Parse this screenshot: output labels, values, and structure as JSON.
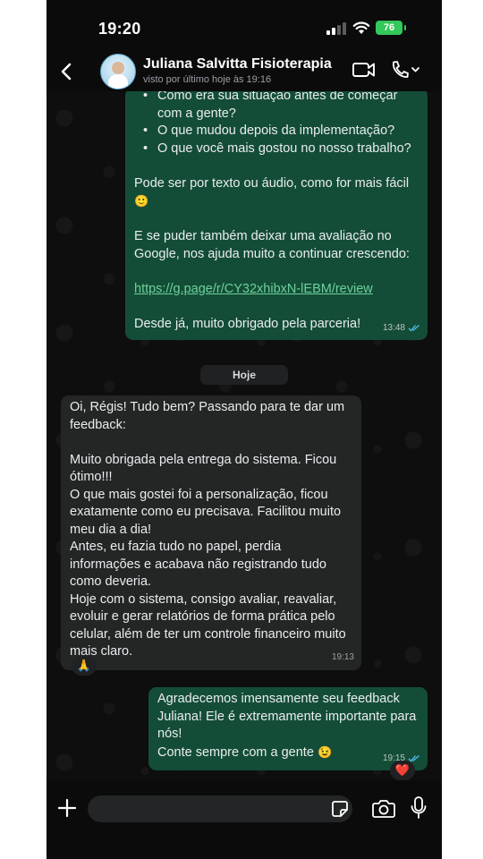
{
  "status_bar": {
    "time": "19:20",
    "battery": "76"
  },
  "header": {
    "contact_name": "Juliana Salvitta Fisioterapia",
    "last_seen": "visto por último hoje às 19:16"
  },
  "messages": {
    "m1": {
      "bullets": [
        "Como era sua situação antes de começar com a gente?",
        "O que mudou depois da implementação?",
        "O que você mais gostou no nosso trabalho?"
      ],
      "text_1": "Pode ser por texto ou áudio, como for mais fácil",
      "text_1_emoji": "🙂",
      "text_2": "E se puder também deixar uma avaliação no Google, nos ajuda muito a continuar crescendo:",
      "link": "https://g.page/r/CY32xhibxN-lEBM/review",
      "text_3": "Desde já, muito obrigado pela parceria!",
      "time": "13:48"
    },
    "day_divider": "Hoje",
    "m2": {
      "lines": [
        "Oi, Régis! Tudo bem? Passando para te dar um feedback:",
        "",
        "Muito obrigada pela entrega do sistema. Ficou ótimo!!!",
        "O que mais gostei foi a personalização, ficou exatamente como eu precisava. Facilitou muito meu dia a dia!",
        "Antes, eu fazia tudo no papel, perdia informações e acabava não registrando tudo como deveria.",
        "Hoje com o sistema, consigo avaliar, reavaliar, evoluir e gerar relatórios de forma prática pelo celular, além de ter um controle financeiro muito mais claro."
      ],
      "time": "19:13",
      "reaction": "🙏"
    },
    "m3": {
      "text_1": "Agradecemos imensamente seu feedback Juliana! Ele é extremamente importante para nós!",
      "text_2": "Conte sempre com a gente",
      "text_2_emoji": "😉",
      "time": "19:15",
      "reaction": "❤️"
    }
  },
  "input": {
    "placeholder": ""
  },
  "colors": {
    "outgoing_bubble": "#144d37",
    "incoming_bubble": "#242626",
    "link": "#6cd19b",
    "read_ticks": "#53bdeb",
    "battery": "#34c759"
  },
  "icons": [
    "back-chevron-icon",
    "video-call-icon",
    "phone-call-icon",
    "read-receipt-icon",
    "plus-icon",
    "sticker-icon",
    "camera-icon",
    "microphone-icon",
    "signal-icon",
    "wifi-icon"
  ]
}
